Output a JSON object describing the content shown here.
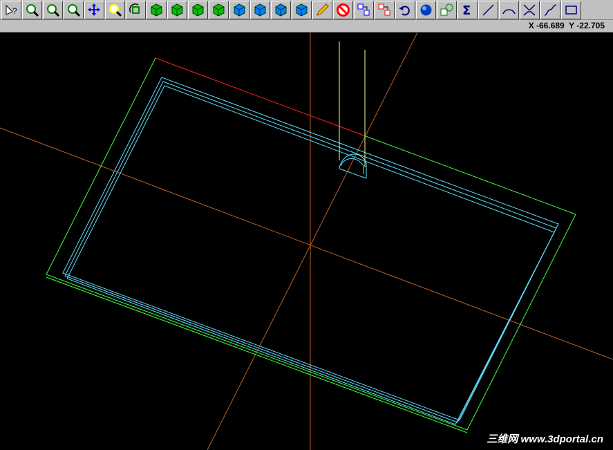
{
  "toolbar": {
    "buttons": [
      {
        "name": "select-help-icon",
        "color": "#000080"
      },
      {
        "name": "zoom-window-icon",
        "color": "#008000"
      },
      {
        "name": "zoom-out-icon",
        "color": "#008000"
      },
      {
        "name": "zoom-extents-icon",
        "color": "#008000"
      },
      {
        "name": "pan-icon",
        "color": "#0000ff"
      },
      {
        "name": "zoom-select-icon",
        "color": "#ffff00"
      },
      {
        "name": "rotate-view-icon",
        "color": "#008000"
      },
      {
        "name": "cube-iso-icon",
        "color": "#00c000"
      },
      {
        "name": "cube-front-icon",
        "color": "#00c000"
      },
      {
        "name": "cube-top-icon",
        "color": "#00c000"
      },
      {
        "name": "cube-side-icon",
        "color": "#00c000"
      },
      {
        "name": "cube-blue-1-icon",
        "color": "#0080ff"
      },
      {
        "name": "cube-blue-2-icon",
        "color": "#0080ff"
      },
      {
        "name": "cube-blue-3-icon",
        "color": "#0080ff"
      },
      {
        "name": "cube-blue-4-icon",
        "color": "#0080ff"
      },
      {
        "name": "pencil-icon",
        "color": "#ffc000"
      },
      {
        "name": "no-entry-icon",
        "color": "#ff0000"
      },
      {
        "name": "layer-move-icon",
        "color": "#0000ff"
      },
      {
        "name": "layer-copy-icon",
        "color": "#ff0000"
      },
      {
        "name": "undo-icon",
        "color": "#000080"
      },
      {
        "name": "sphere-icon",
        "color": "#0040c0"
      },
      {
        "name": "shapes-icon",
        "color": "#008000"
      },
      {
        "name": "sigma-icon",
        "color": "#000080"
      },
      {
        "name": "line-icon",
        "color": "#000080"
      },
      {
        "name": "arc-icon",
        "color": "#000080"
      },
      {
        "name": "fillet-icon",
        "color": "#000080"
      },
      {
        "name": "spline-icon",
        "color": "#000080"
      },
      {
        "name": "rectangle-icon",
        "color": "#000080"
      }
    ]
  },
  "status": {
    "coords": "X -66.689  Y -22.705"
  },
  "viewport": {
    "background": "#000000",
    "axis_color": "#c06020",
    "outer_boundary_color": "#40ff40",
    "far_edge_color": "#ff2020",
    "part_color": "#60e0ff",
    "tool_color": "#ffff80"
  },
  "watermark": {
    "text": "三维网 www.3dportal.cn"
  }
}
